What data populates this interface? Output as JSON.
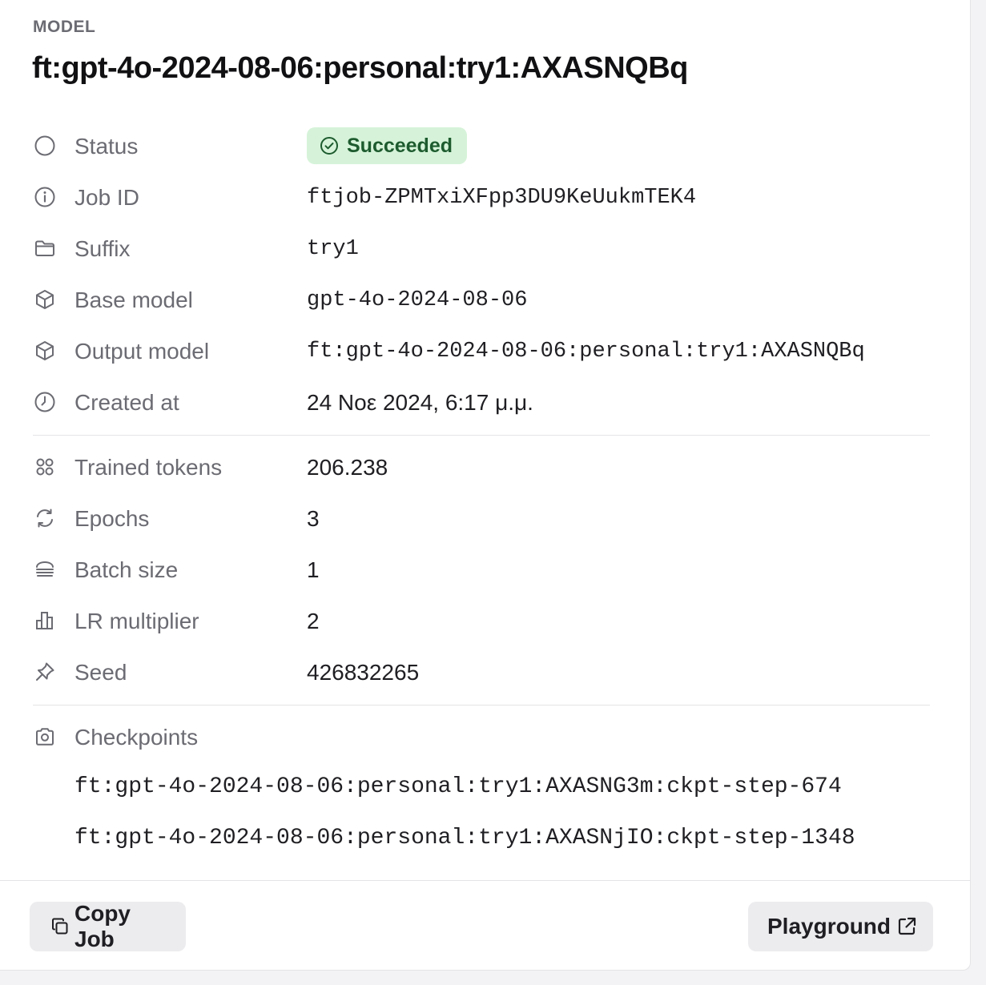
{
  "header": {
    "section_label": "MODEL",
    "model_name": "ft:gpt-4o-2024-08-06:personal:try1:AXASNQBq"
  },
  "details": {
    "status": {
      "label": "Status",
      "value": "Succeeded",
      "icon": "circle-icon",
      "badge_color": "#d6f3d9"
    },
    "job_id": {
      "label": "Job ID",
      "value": "ftjob-ZPMTxiXFpp3DU9KeUukmTEK4",
      "icon": "info-icon"
    },
    "suffix": {
      "label": "Suffix",
      "value": "try1",
      "icon": "folder-icon"
    },
    "base_model": {
      "label": "Base model",
      "value": "gpt-4o-2024-08-06",
      "icon": "cube-icon"
    },
    "output_model": {
      "label": "Output model",
      "value": "ft:gpt-4o-2024-08-06:personal:try1:AXASNQBq",
      "icon": "cube-icon"
    },
    "created_at": {
      "label": "Created at",
      "value": "24 Νοε 2024, 6:17 μ.μ.",
      "icon": "clock-icon"
    }
  },
  "hyperparams": {
    "trained_tokens": {
      "label": "Trained tokens",
      "value": "206.238",
      "icon": "grid-dots-icon"
    },
    "epochs": {
      "label": "Epochs",
      "value": "3",
      "icon": "refresh-icon"
    },
    "batch_size": {
      "label": "Batch size",
      "value": "1",
      "icon": "stack-icon"
    },
    "lr_multiplier": {
      "label": "LR multiplier",
      "value": "2",
      "icon": "bar-chart-icon"
    },
    "seed": {
      "label": "Seed",
      "value": "426832265",
      "icon": "pin-icon"
    }
  },
  "checkpoints": {
    "label": "Checkpoints",
    "icon": "camera-icon",
    "items": [
      "ft:gpt-4o-2024-08-06:personal:try1:AXASNG3m:ckpt-step-674",
      "ft:gpt-4o-2024-08-06:personal:try1:AXASNjIO:ckpt-step-1348"
    ]
  },
  "footer": {
    "copy_job_label": "Copy Job",
    "playground_label": "Playground"
  }
}
